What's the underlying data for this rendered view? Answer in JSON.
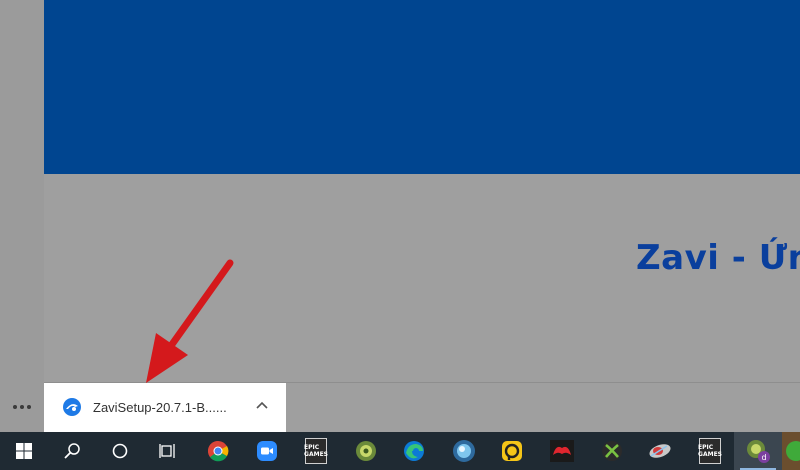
{
  "page": {
    "headline": "Zavi - Ứng"
  },
  "downloads_bar": {
    "more_icon": "more-horizontal-icon",
    "item": {
      "file_name": "ZaviSetup-20.7.1-B......",
      "icon": "zavi-app-icon",
      "toggle_icon": "chevron-up-icon"
    }
  },
  "annotation": {
    "arrow_icon": "red-arrow-icon",
    "color": "#d4191c"
  },
  "taskbar": {
    "items": [
      {
        "icon": "windows-start-icon"
      },
      {
        "icon": "search-icon"
      },
      {
        "icon": "cortana-icon"
      },
      {
        "icon": "task-view-icon"
      },
      {
        "icon": "chrome-icon"
      },
      {
        "icon": "zoom-icon"
      },
      {
        "icon": "epic-games-icon",
        "label": "EPIC GAMES"
      },
      {
        "icon": "cyberlink-icon"
      },
      {
        "icon": "edge-icon"
      },
      {
        "icon": "ball-app-icon"
      },
      {
        "icon": "ldplayer-icon"
      },
      {
        "icon": "garena-icon"
      },
      {
        "icon": "xbox-icon"
      },
      {
        "icon": "globe-app-icon"
      },
      {
        "icon": "epic-games-icon",
        "label": "EPIC GAMES"
      },
      {
        "icon": "cyberlink-user-icon",
        "badge": "d"
      },
      {
        "icon": "green-app-icon"
      }
    ]
  },
  "colors": {
    "hero_blue": "#004590",
    "headline_blue": "#0a3f9d",
    "taskbar_bg": "#1f2a33",
    "overlay_gray": "#9f9f9f"
  }
}
